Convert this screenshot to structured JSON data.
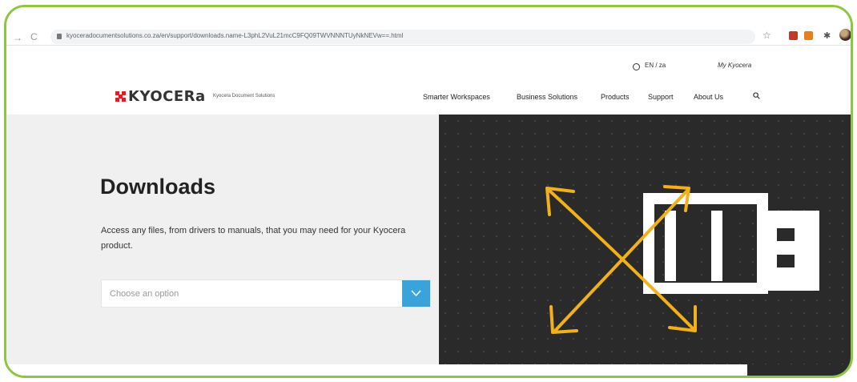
{
  "browser": {
    "url": "kyoceradocumentsolutions.co.za/en/support/downloads.name-L3phL2VuL21mcC9FQ09TWVNNNTUyNkNEVw==.html"
  },
  "topbar": {
    "language": "EN / za",
    "my_account": "My Kyocera"
  },
  "header": {
    "logo_text": "KYOCERa",
    "logo_subtitle": "Kyocera Document Solutions",
    "nav": [
      "Smarter Workspaces",
      "Business Solutions",
      "Products",
      "Support",
      "About Us"
    ]
  },
  "hero": {
    "title": "Downloads",
    "description": "Access any files, from drivers to manuals, that you may need for your Kyocera product.",
    "select_placeholder": "Choose an option"
  },
  "colors": {
    "frame_border": "#8dc63f",
    "select_button": "#3aa3d9",
    "artwork_bg": "#2a2a2a",
    "artwork_arrows": "#f2b11b",
    "logo_red": "#e02020"
  },
  "icons": [
    "back-icon",
    "reload-icon",
    "lock-icon",
    "star-icon",
    "extension-icon",
    "puzzle-icon",
    "profile-avatar",
    "globe-icon",
    "search-icon",
    "chevron-down-icon"
  ]
}
